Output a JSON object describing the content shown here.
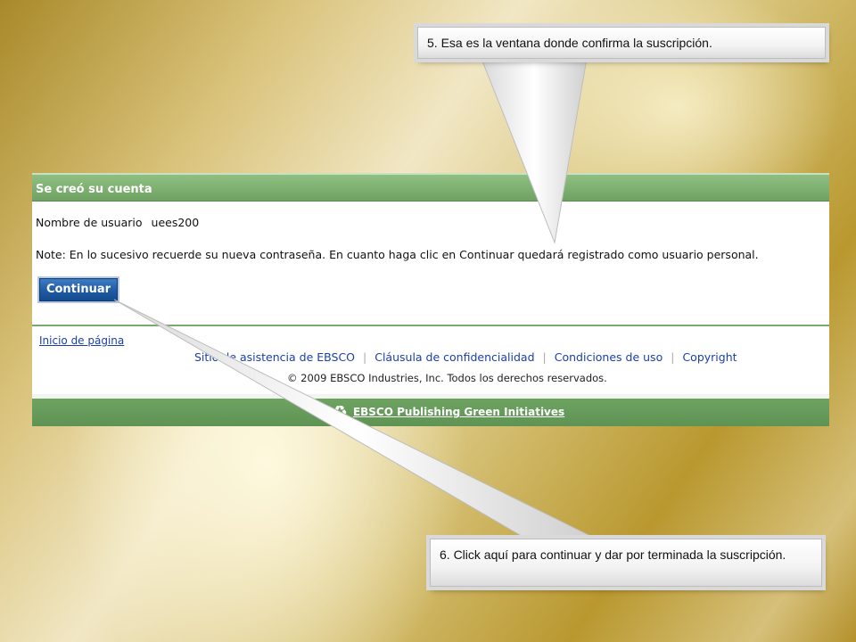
{
  "callouts": {
    "step5": "5. Esa es la ventana donde confirma la suscripción.",
    "step6": "6. Click aquí para continuar y dar por terminada la suscripción."
  },
  "ebsco": {
    "header_title": "Se creó su cuenta",
    "username_label": "Nombre de usuario",
    "username_value": "uees200",
    "note": "Note: En lo sucesivo recuerde su nueva contraseña. En cuanto haga clic en Continuar quedará registrado como usuario personal.",
    "continue_button": "Continuar",
    "top_link": "Inicio de página",
    "footer_links": [
      "Sitio de asistencia de EBSCO",
      "Cláusula de confidencialidad",
      "Condiciones de uso",
      "Copyright"
    ],
    "copyright": "© 2009 EBSCO Industries, Inc. Todos los derechos reservados.",
    "green_initiatives": "EBSCO Publishing Green Initiatives",
    "green_icon": "recycle-icon"
  },
  "colors": {
    "header_green": "#6fa362",
    "button_blue": "#1f5aa3",
    "link_blue": "#1a3fa8"
  }
}
